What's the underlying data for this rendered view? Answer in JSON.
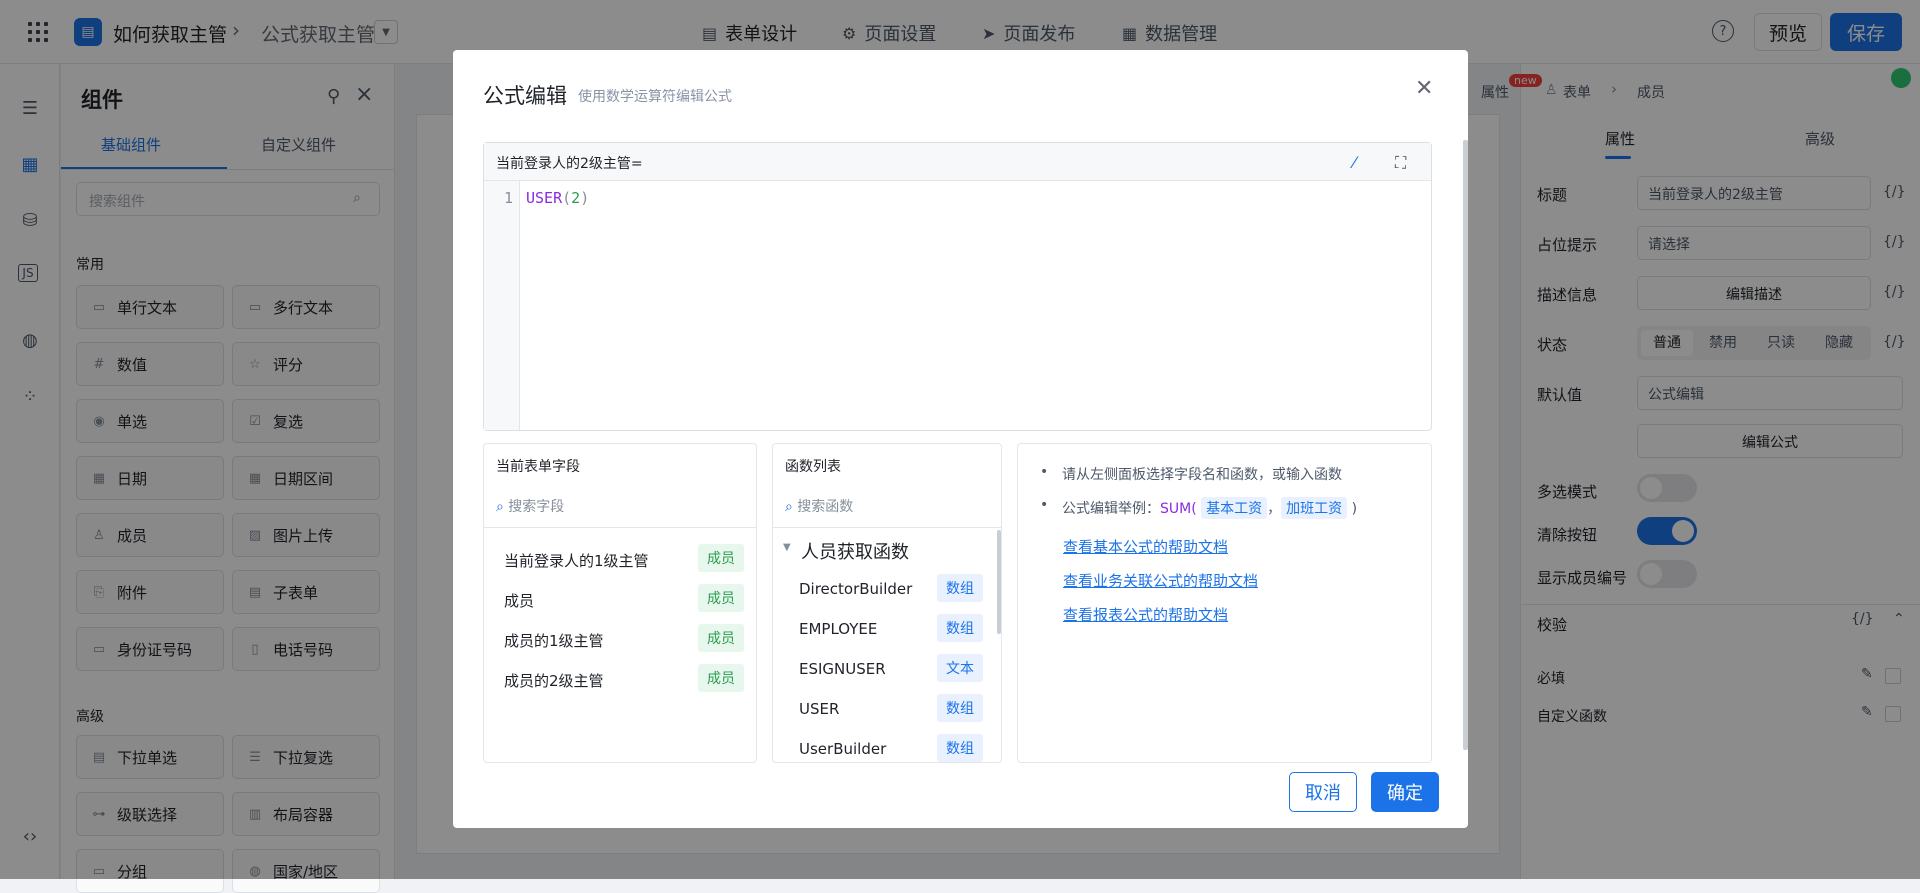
{
  "header": {
    "app_name": "如何获取主管",
    "form_name": "公式获取主管",
    "nav_tabs": [
      "表单设计",
      "页面设置",
      "页面发布",
      "数据管理"
    ],
    "help": "?",
    "preview": "预览",
    "save": "保存"
  },
  "left_panel": {
    "title": "组件",
    "tabs": [
      "基础组件",
      "自定义组件"
    ],
    "search_placeholder": "搜索组件",
    "section_common": "常用",
    "section_advanced": "高级",
    "components": [
      "单行文本",
      "多行文本",
      "数值",
      "评分",
      "单选",
      "复选",
      "日期",
      "日期区间",
      "成员",
      "图片上传",
      "附件",
      "子表单",
      "身份证号码",
      "电话号码"
    ],
    "advanced_components": [
      "下拉单选",
      "下拉复选",
      "级联选择",
      "布局容器",
      "分组",
      "国家/地区"
    ]
  },
  "right_panel": {
    "tab_badge": "new",
    "tab_attr_label": "属性",
    "breadcrumb": [
      "表单",
      "成员"
    ],
    "tabs": [
      "属性",
      "高级"
    ],
    "title_label": "标题",
    "title_value": "当前登录人的2级主管",
    "placeholder_label": "占位提示",
    "placeholder_value": "请选择",
    "desc_label": "描述信息",
    "desc_button": "编辑描述",
    "state_label": "状态",
    "states": [
      "普通",
      "禁用",
      "只读",
      "隐藏"
    ],
    "default_label": "默认值",
    "default_value": "公式编辑",
    "edit_formula": "编辑公式",
    "multi_label": "多选模式",
    "multi_on": false,
    "clear_label": "清除按钮",
    "clear_on": true,
    "show_no_label": "显示成员编号",
    "show_no_on": false,
    "validate_label": "校验",
    "required_label": "必填",
    "custom_fn_label": "自定义函数",
    "fx": "{/}"
  },
  "modal": {
    "title": "公式编辑",
    "subtitle": "使用数学运算符编辑公式",
    "editor_label": "当前登录人的2级主管=",
    "line_no": "1",
    "code_fn": "USER",
    "code_open": "(",
    "code_arg": "2",
    "code_close": ")",
    "fields_title": "当前表单字段",
    "fields_search": "搜索字段",
    "fields": [
      {
        "name": "当前登录人的1级主管",
        "tag": "成员"
      },
      {
        "name": "成员",
        "tag": "成员"
      },
      {
        "name": "成员的1级主管",
        "tag": "成员"
      },
      {
        "name": "成员的2级主管",
        "tag": "成员"
      }
    ],
    "func_title": "函数列表",
    "func_search": "搜索函数",
    "func_group": "人员获取函数",
    "functions": [
      {
        "name": "DirectorBuilder",
        "tag": "数组"
      },
      {
        "name": "EMPLOYEE",
        "tag": "数组"
      },
      {
        "name": "ESIGNUSER",
        "tag": "文本"
      },
      {
        "name": "USER",
        "tag": "数组"
      },
      {
        "name": "UserBuilder",
        "tag": "数组"
      }
    ],
    "help1": "请从左侧面板选择字段名和函数，或输入函数",
    "help2_prefix": "公式编辑举例：",
    "help2_fn": "SUM(",
    "help2_a": "基本工资",
    "help2_sep": "，",
    "help2_b": "加班工资",
    "help2_close": ")",
    "links": [
      "查看基本公式的帮助文档",
      "查看业务关联公式的帮助文档",
      "查看报表公式的帮助文档"
    ],
    "cancel": "取消",
    "confirm": "确定"
  }
}
